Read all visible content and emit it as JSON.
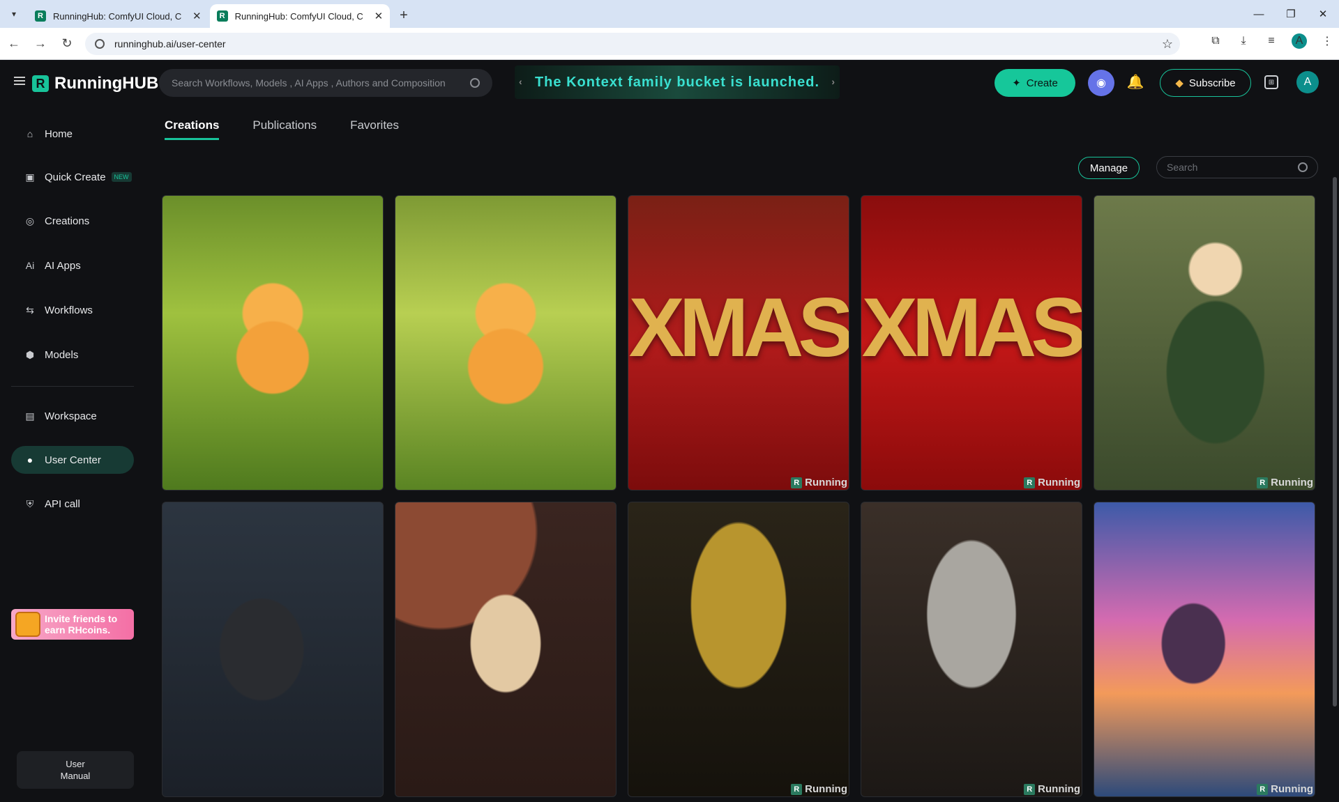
{
  "browser": {
    "tabs": [
      {
        "title": "RunningHub: ComfyUI Cloud, C",
        "active": false
      },
      {
        "title": "RunningHub: ComfyUI Cloud, C",
        "active": true
      }
    ],
    "url": "runninghub.ai/user-center"
  },
  "header": {
    "logo": "RunningHUB",
    "search_placeholder": "Search Workflows, Models , AI Apps , Authors and Composition",
    "banner_text": "The Kontext family bucket is launched.",
    "create_label": "Create",
    "subscribe_label": "Subscribe",
    "avatar_letter": "A"
  },
  "sidebar": {
    "items": [
      {
        "label": "Home",
        "icon": "home-icon"
      },
      {
        "label": "Quick Create",
        "icon": "quick-create-icon",
        "badge": "NEW"
      },
      {
        "label": "Creations",
        "icon": "creations-icon"
      },
      {
        "label": "AI Apps",
        "icon": "ai-apps-icon"
      },
      {
        "label": "Workflows",
        "icon": "workflows-icon"
      },
      {
        "label": "Models",
        "icon": "models-icon"
      },
      {
        "label": "Workspace",
        "icon": "workspace-icon"
      },
      {
        "label": "User Center",
        "icon": "user-icon",
        "active": true
      },
      {
        "label": "API call",
        "icon": "api-icon"
      }
    ],
    "invite": "Invite friends to earn RHcoins.",
    "manual": "User Manual"
  },
  "content": {
    "tabs": [
      "Creations",
      "Publications",
      "Favorites"
    ],
    "manage_label": "Manage",
    "search_placeholder": "Search",
    "watermark": "Running",
    "cards": [
      {
        "subject": "cat-forest",
        "text": ""
      },
      {
        "subject": "cat-forest",
        "text": ""
      },
      {
        "subject": "xmas-red",
        "text": "XMAS"
      },
      {
        "subject": "xmas-red",
        "text": "XMAS"
      },
      {
        "subject": "elf-warrior",
        "text": ""
      },
      {
        "subject": "space-chest-red",
        "text": ""
      },
      {
        "subject": "space-chest-gold",
        "text": ""
      },
      {
        "subject": "robot-gold",
        "text": ""
      },
      {
        "subject": "robot-silver",
        "text": ""
      },
      {
        "subject": "pixel-beach-house",
        "text": ""
      }
    ]
  },
  "colors": {
    "accent": "#18c39a",
    "bg": "#101114"
  }
}
